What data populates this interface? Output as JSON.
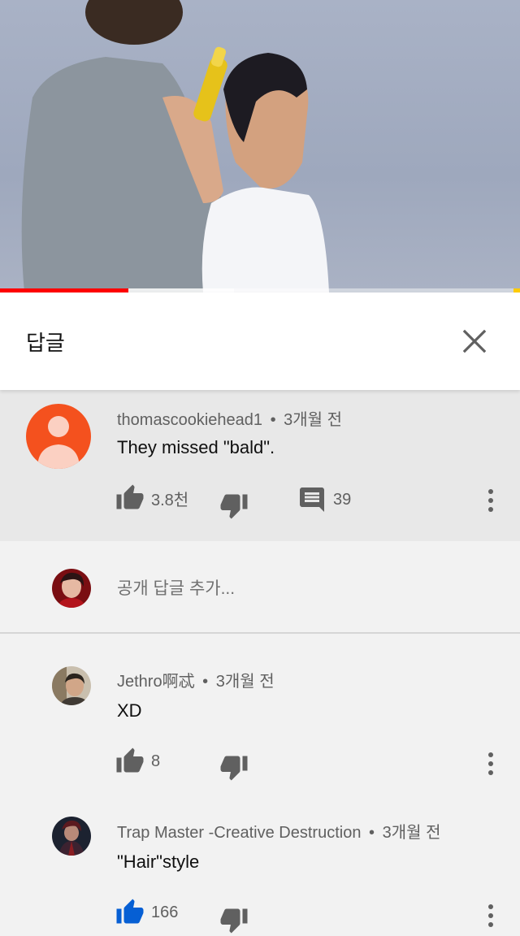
{
  "sheet": {
    "title": "답글"
  },
  "video": {
    "progress_fraction": 0.247,
    "buffered_fraction": 0.45
  },
  "parent_comment": {
    "author": "thomascookiehead1",
    "age": "3개월 전",
    "text": "They missed \"bald\".",
    "likes": "3.8천",
    "replies": "39"
  },
  "reply_input": {
    "placeholder": "공개 답글 추가..."
  },
  "replies": [
    {
      "author": "Jethro啊忒",
      "age": "3개월 전",
      "text": "XD",
      "likes": "8",
      "liked": false
    },
    {
      "author": "Trap Master -Creative Destruction",
      "age": "3개월 전",
      "text": "\"Hair\"style",
      "likes": "166",
      "liked": true
    }
  ],
  "colors": {
    "progress": "#ff0000",
    "liked": "#065fd4",
    "avatar_default": "#f4511e",
    "icon": "#606060"
  },
  "separator": "•"
}
